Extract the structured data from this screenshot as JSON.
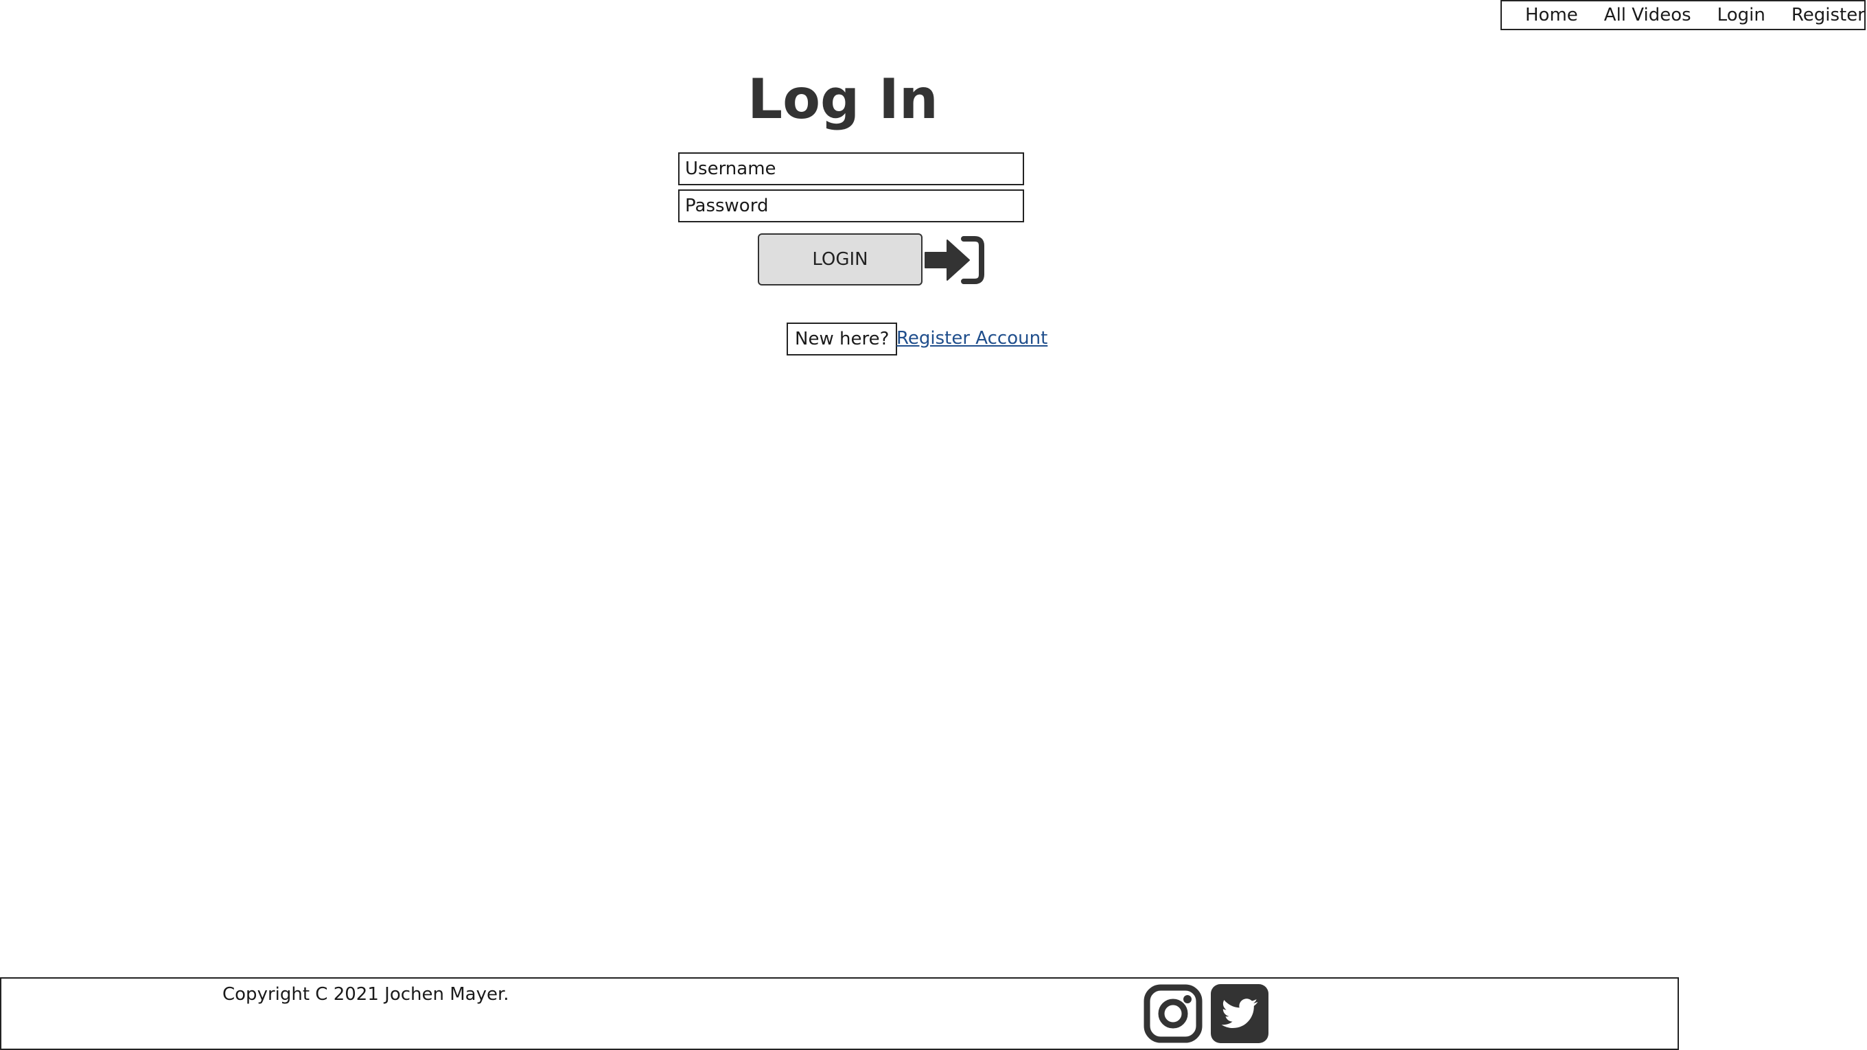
{
  "nav": {
    "home": "Home",
    "all_videos": "All Videos",
    "login": "Login",
    "register": "Register"
  },
  "page": {
    "title": "Log In"
  },
  "form": {
    "username_placeholder": "Username",
    "password_placeholder": "Password",
    "login_button": "LOGIN",
    "login_icon": "sign-in-icon",
    "new_here": "New here?",
    "register_link": "Register Account"
  },
  "footer": {
    "copyright": "Copyright C 2021 Jochen Mayer.",
    "social": [
      {
        "icon": "instagram-icon"
      },
      {
        "icon": "twitter-icon"
      }
    ]
  },
  "colors": {
    "link": "#1f4e8c",
    "button_bg": "#dedede",
    "icon": "#333333"
  }
}
